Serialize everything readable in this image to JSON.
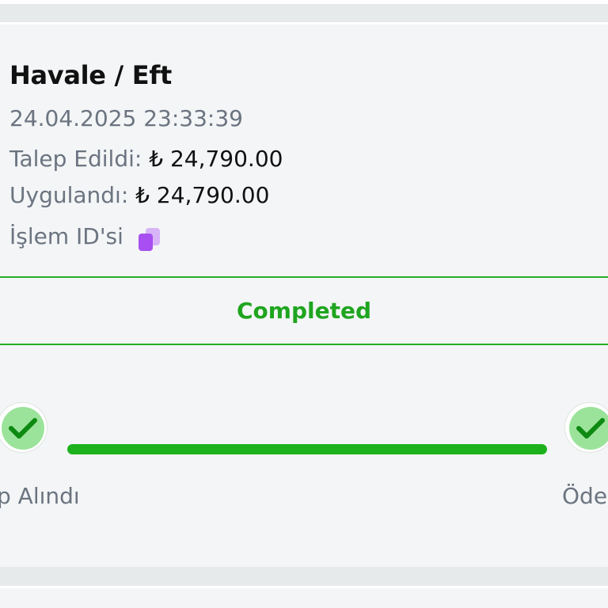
{
  "transaction": {
    "title": "Havale / Eft",
    "datetime": "24.04.2025 23:33:39",
    "requested_label": "Talep Edildi:",
    "requested_value": "₺ 24,790.00",
    "applied_label": "Uygulandı:",
    "applied_value": "₺ 24,790.00",
    "id_label": "İşlem ID'si",
    "copy_icon": "copy-icon"
  },
  "status": {
    "label": "Completed",
    "color": "#1fa51f"
  },
  "progress": {
    "steps": [
      {
        "label": "p Alındı",
        "state": "done",
        "icon": "check-icon"
      },
      {
        "label": "Öde",
        "state": "done",
        "icon": "check-icon"
      }
    ],
    "fill": 1.0,
    "color": "#1db21d"
  },
  "colors": {
    "accent_green": "#1db21d",
    "step_fill": "#9be39b",
    "copy_icon": "#a855f7"
  }
}
